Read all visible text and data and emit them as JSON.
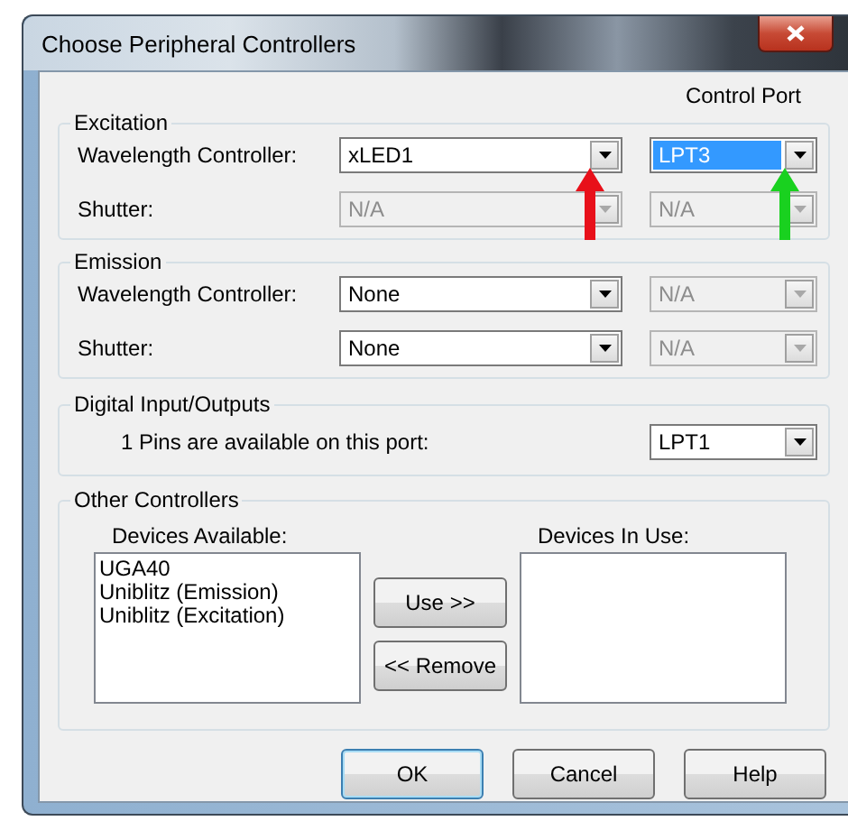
{
  "window": {
    "title": "Choose Peripheral Controllers"
  },
  "control_port_header": "Control Port",
  "groups": [
    {
      "title": "Excitation",
      "rows": [
        {
          "label": "Wavelength Controller:",
          "controller": {
            "value": "xLED1",
            "disabled": false,
            "highlighted": false,
            "annotation_arrow": {
              "color": "#e8101a"
            }
          },
          "port": {
            "value": "LPT3",
            "disabled": false,
            "highlighted": true,
            "annotation_arrow": {
              "color": "#19d11f"
            }
          }
        },
        {
          "label": "Shutter:",
          "controller": {
            "value": "N/A",
            "disabled": true,
            "highlighted": false
          },
          "port": {
            "value": "N/A",
            "disabled": true,
            "highlighted": false
          }
        }
      ]
    },
    {
      "title": "Emission",
      "rows": [
        {
          "label": "Wavelength Controller:",
          "controller": {
            "value": "None",
            "disabled": false,
            "highlighted": false
          },
          "port": {
            "value": "N/A",
            "disabled": true,
            "highlighted": false
          }
        },
        {
          "label": "Shutter:",
          "controller": {
            "value": "None",
            "disabled": false,
            "highlighted": false
          },
          "port": {
            "value": "N/A",
            "disabled": true,
            "highlighted": false
          }
        }
      ]
    }
  ],
  "digital": {
    "title": "Digital Input/Outputs",
    "label": "1 Pins are available on this port:",
    "port": {
      "value": "LPT1",
      "disabled": false,
      "highlighted": false
    }
  },
  "other": {
    "title": "Other Controllers",
    "available_label": "Devices Available:",
    "available": [
      "UGA40",
      "Uniblitz (Emission)",
      "Uniblitz (Excitation)"
    ],
    "use_button": "Use >>",
    "remove_button": "<< Remove",
    "in_use_label": "Devices In Use:"
  },
  "buttons": [
    {
      "label": "OK",
      "default": true
    },
    {
      "label": "Cancel",
      "default": false
    },
    {
      "label": "Help",
      "default": false
    }
  ]
}
